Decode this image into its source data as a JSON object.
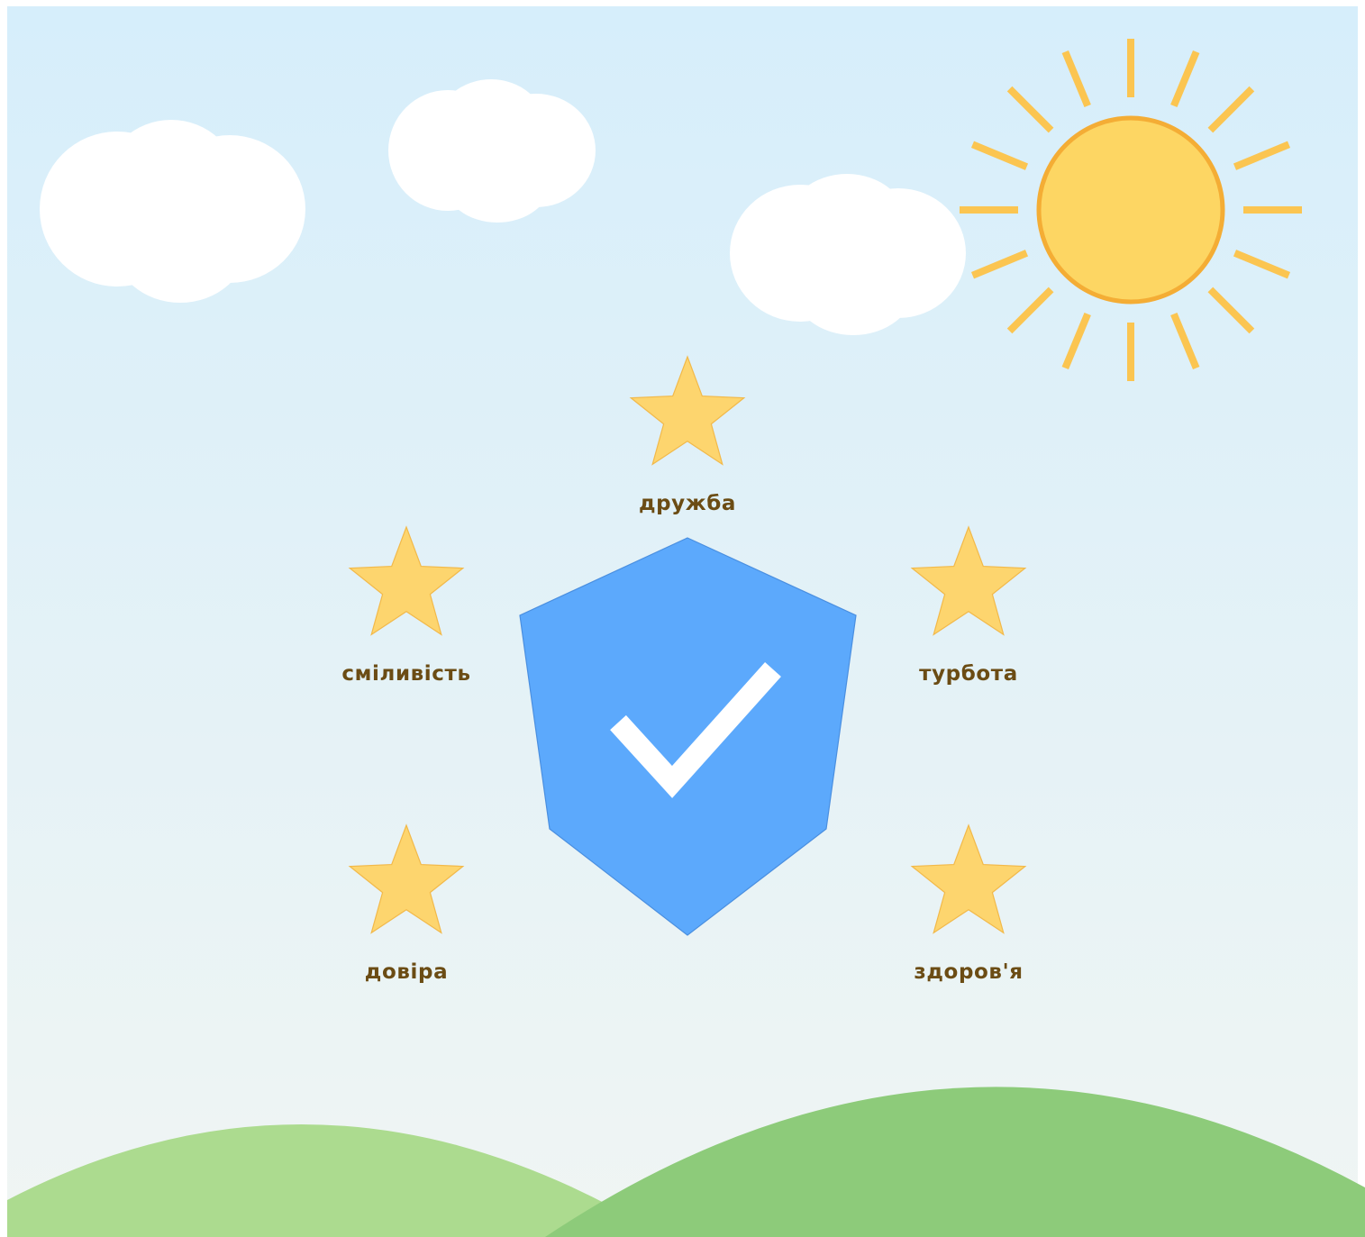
{
  "colors": {
    "sky_top": "#d6eefb",
    "sky_bottom": "#f0f5f3",
    "cloud": "#ffffff",
    "sun_fill": "#fdd663",
    "sun_stroke": "#f4ad35",
    "sun_ray": "#fbc551",
    "star_fill": "#fdd56e",
    "star_stroke": "#f2b94a",
    "shield_fill": "#5ca9fc",
    "shield_stroke": "#4a8fe0",
    "checkmark": "#ffffff",
    "hill_back": "#acdb8f",
    "hill_front": "#8dcb7a",
    "label_text": "#6b4c14"
  },
  "icons": {
    "sun": "sun-icon",
    "cloud": "cloud-icon",
    "star": "star-icon",
    "shield": "shield-check-icon"
  },
  "values": [
    {
      "id": "friendship",
      "label": "дружба"
    },
    {
      "id": "courage",
      "label": "сміливість"
    },
    {
      "id": "care",
      "label": "турбота"
    },
    {
      "id": "trust",
      "label": "довіра"
    },
    {
      "id": "health",
      "label": "здоров'я"
    }
  ]
}
